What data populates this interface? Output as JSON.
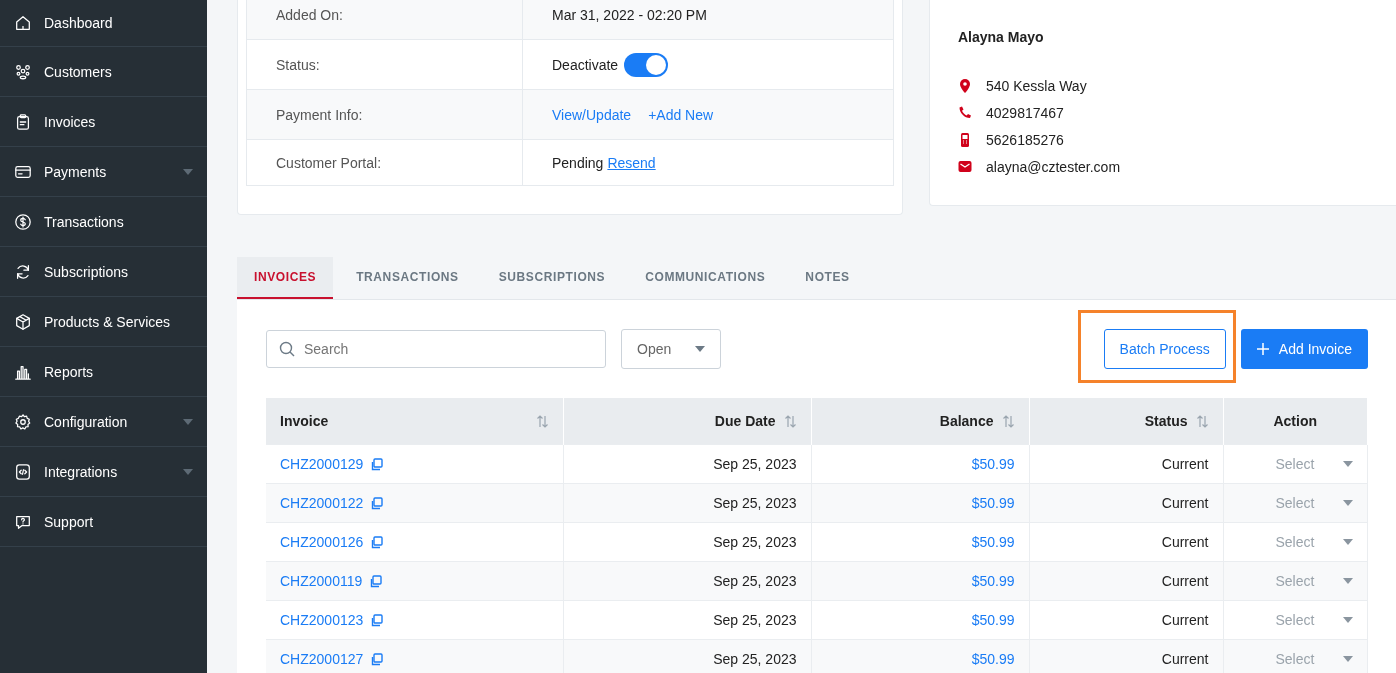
{
  "sidebar": {
    "items": [
      {
        "label": "Dashboard",
        "has_submenu": false
      },
      {
        "label": "Customers",
        "has_submenu": false
      },
      {
        "label": "Invoices",
        "has_submenu": false
      },
      {
        "label": "Payments",
        "has_submenu": true
      },
      {
        "label": "Transactions",
        "has_submenu": false
      },
      {
        "label": "Subscriptions",
        "has_submenu": false
      },
      {
        "label": "Products & Services",
        "has_submenu": false
      },
      {
        "label": "Reports",
        "has_submenu": false
      },
      {
        "label": "Configuration",
        "has_submenu": true
      },
      {
        "label": "Integrations",
        "has_submenu": true
      },
      {
        "label": "Support",
        "has_submenu": false
      }
    ]
  },
  "details": {
    "rows": [
      {
        "kind": "text",
        "label": "Added On:",
        "value": "Mar 31, 2022 - 02:20 PM"
      },
      {
        "kind": "toggle",
        "label": "Status:",
        "value": "Deactivate",
        "on": true
      },
      {
        "kind": "links",
        "label": "Payment Info:",
        "links": [
          "View/Update",
          "+Add New"
        ]
      },
      {
        "kind": "portal",
        "label": "Customer Portal:",
        "value": "Pending",
        "link": "Resend"
      }
    ]
  },
  "contact": {
    "name": "Alayna Mayo",
    "lines": [
      {
        "kind": "address",
        "text": "540 Kessla Way"
      },
      {
        "kind": "phone",
        "text": "4029817467"
      },
      {
        "kind": "mobile",
        "text": "5626185276"
      },
      {
        "kind": "email",
        "text": "alayna@cztester.com"
      }
    ]
  },
  "tabs": [
    {
      "label": "INVOICES",
      "selected": true
    },
    {
      "label": "TRANSACTIONS",
      "selected": false
    },
    {
      "label": "SUBSCRIPTIONS",
      "selected": false
    },
    {
      "label": "COMMUNICATIONS",
      "selected": false
    },
    {
      "label": "NOTES",
      "selected": false
    }
  ],
  "toolbar": {
    "search": {
      "placeholder": "Search"
    },
    "filter": "Open",
    "batch_button": "Batch Process",
    "add_button": "Add Invoice"
  },
  "table": {
    "columns": [
      {
        "label": "Invoice",
        "sortable": true
      },
      {
        "label": "Due Date",
        "sortable": true
      },
      {
        "label": "Balance",
        "sortable": true
      },
      {
        "label": "Status",
        "sortable": true
      },
      {
        "label": "Action",
        "sortable": false
      }
    ],
    "rows": [
      {
        "invoice": "CHZ2000129",
        "due": "Sep 25, 2023",
        "balance": "$50.99",
        "status": "Current",
        "action": "Select"
      },
      {
        "invoice": "CHZ2000122",
        "due": "Sep 25, 2023",
        "balance": "$50.99",
        "status": "Current",
        "action": "Select"
      },
      {
        "invoice": "CHZ2000126",
        "due": "Sep 25, 2023",
        "balance": "$50.99",
        "status": "Current",
        "action": "Select"
      },
      {
        "invoice": "CHZ2000119",
        "due": "Sep 25, 2023",
        "balance": "$50.99",
        "status": "Current",
        "action": "Select"
      },
      {
        "invoice": "CHZ2000123",
        "due": "Sep 25, 2023",
        "balance": "$50.99",
        "status": "Current",
        "action": "Select"
      },
      {
        "invoice": "CHZ2000127",
        "due": "Sep 25, 2023",
        "balance": "$50.99",
        "status": "Current",
        "action": "Select"
      }
    ]
  }
}
